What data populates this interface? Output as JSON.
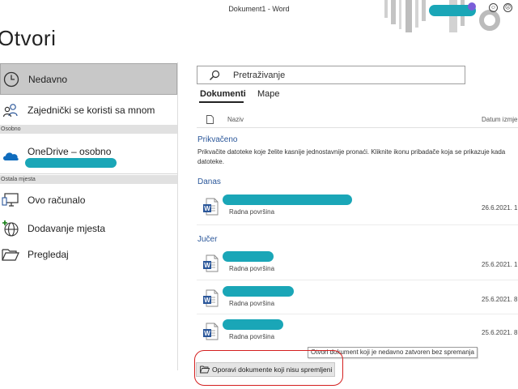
{
  "window": {
    "title": "Dokument1 - Word"
  },
  "page": {
    "heading": "Otvori"
  },
  "nav": {
    "recent": "Nedavno",
    "shared": "Zajednički se koristi sa mnom",
    "section_personal": "Osobno",
    "onedrive": "OneDrive – osobno",
    "section_other": "Ostala mjesta",
    "this_pc": "Ovo računalo",
    "add_place": "Dodavanje mjesta",
    "browse": "Pregledaj"
  },
  "search": {
    "placeholder": "Pretraživanje"
  },
  "tabs": [
    {
      "label": "Dokumenti"
    },
    {
      "label": "Mape"
    }
  ],
  "list": {
    "col_name": "Naziv",
    "col_date": "Datum izmje",
    "pinned_title": "Prikvačeno",
    "pinned_text": "Prikvačite datoteke koje želite kasnije jednostavnije pronaći. Kliknite ikonu pribadače koja se prikazuje kada datoteke.",
    "today_title": "Danas",
    "yesterday_title": "Jučer"
  },
  "files": [
    {
      "location": "Radna površina",
      "date": "26.6.2021. 1"
    },
    {
      "location": "Radna površina",
      "date": "25.6.2021. 1"
    },
    {
      "location": "Radna površina",
      "date": "25.6.2021. 8"
    },
    {
      "location": "Radna površina",
      "date": "25.6.2021. 8"
    }
  ],
  "tooltip": "Otvori dokument koji je nedavno zatvoren bez spremanja",
  "recover_button": "Oporavi dokumente koji nisu spremljeni",
  "icons": [
    "clock-icon",
    "people-icon",
    "onedrive-cloud-icon",
    "computer-icon",
    "globe-add-icon",
    "folder-open-icon",
    "search-icon",
    "document-icon",
    "word-file-icon",
    "smile-icon",
    "frown-icon"
  ],
  "colors": {
    "accent_blue": "#2b579a",
    "redaction": "#1aa6b7",
    "highlight_red": "#d41f1f",
    "selected_nav": "#c8c8c8"
  }
}
